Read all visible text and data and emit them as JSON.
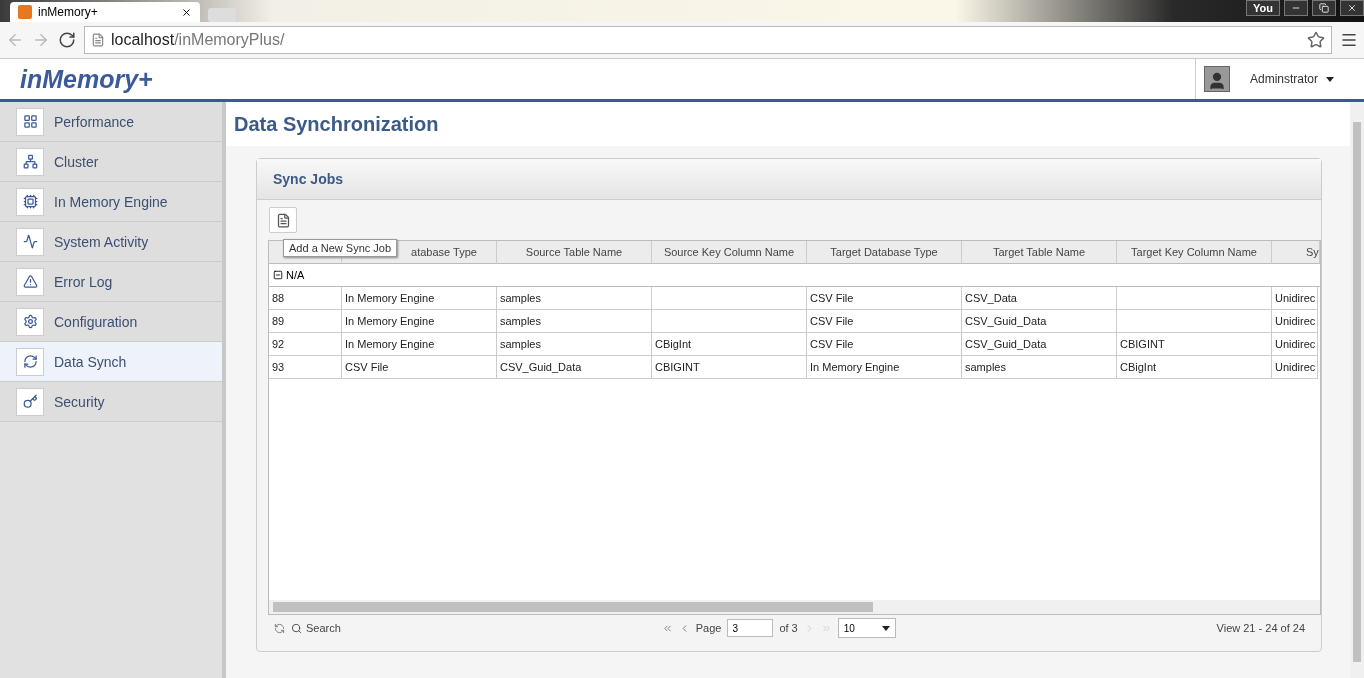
{
  "browser": {
    "tab_title": "inMemory+",
    "url_host": "localhost",
    "url_path": "/inMemoryPlus/",
    "profile": "You"
  },
  "header": {
    "logo": "inMemory+",
    "user": "Adminstrator"
  },
  "sidebar": {
    "items": [
      {
        "label": "Performance",
        "kind": "performance",
        "selected": false
      },
      {
        "label": "Cluster",
        "kind": "cluster",
        "selected": false
      },
      {
        "label": "In Memory Engine",
        "kind": "engine",
        "selected": false
      },
      {
        "label": "System Activity",
        "kind": "activity",
        "selected": false
      },
      {
        "label": "Error Log",
        "kind": "error",
        "selected": false
      },
      {
        "label": "Configuration",
        "kind": "config",
        "selected": false
      },
      {
        "label": "Data Synch",
        "kind": "sync",
        "selected": true
      },
      {
        "label": "Security",
        "kind": "security",
        "selected": false
      }
    ]
  },
  "page_title": "Data Synchronization",
  "panel": {
    "title": "Sync Jobs",
    "tooltip": "Add a New Sync Job",
    "table": {
      "columns": [
        "",
        "atabase Type",
        "Source Table Name",
        "Source Key Column Name",
        "Target Database Type",
        "Target Table Name",
        "Target Key Column Name",
        "Sy"
      ],
      "group": {
        "label": "N/A",
        "expanded": true
      },
      "rows": [
        [
          "88",
          "In Memory Engine",
          "samples",
          "",
          "CSV File",
          "CSV_Data",
          "",
          "Unidirec"
        ],
        [
          "89",
          "In Memory Engine",
          "samples",
          "",
          "CSV File",
          "CSV_Guid_Data",
          "",
          "Unidirec"
        ],
        [
          "92",
          "In Memory Engine",
          "samples",
          "CBigInt",
          "CSV File",
          "CSV_Guid_Data",
          "CBIGINT",
          "Unidirec"
        ],
        [
          "93",
          "CSV File",
          "CSV_Guid_Data",
          "CBIGINT",
          "In Memory Engine",
          "samples",
          "CBigInt",
          "Unidirec"
        ]
      ]
    },
    "pager": {
      "search": "Search",
      "page_label": "Page",
      "page": "3",
      "of": "of 3",
      "page_size": "10",
      "summary": "View 21 - 24 of 24"
    }
  }
}
